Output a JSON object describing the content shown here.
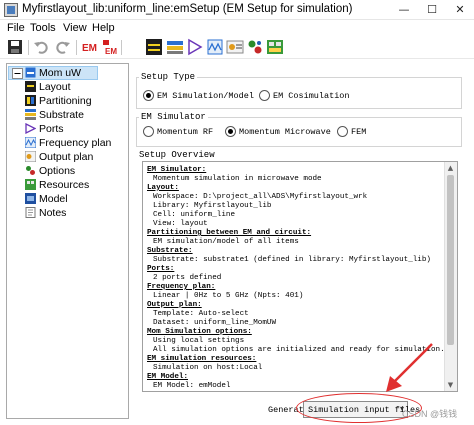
{
  "window": {
    "title": "Myfirstlayout_lib:uniform_line:emSetup (EM Setup for simulation)",
    "minimize": "—",
    "maximize": "☐",
    "close": "✕"
  },
  "menu": {
    "items": [
      "File",
      "Tools",
      "View",
      "Help"
    ]
  },
  "toolbar": {
    "buttons": [
      "save-icon",
      "undo-icon",
      "redo-icon",
      "em-icon",
      "em-cosim-icon",
      "layout-icon",
      "substrate-icon",
      "ports-icon",
      "frequency-icon",
      "output-icon",
      "options-icon",
      "resources-icon"
    ]
  },
  "tree": {
    "root": "Mom uW",
    "items": [
      "Layout",
      "Partitioning",
      "Substrate",
      "Ports",
      "Frequency plan",
      "Output plan",
      "Options",
      "Resources",
      "Model",
      "Notes"
    ]
  },
  "setup_type": {
    "group_label": "Setup Type",
    "options": [
      "EM Simulation/Model",
      "EM Cosimulation"
    ],
    "selected": "EM Simulation/Model"
  },
  "em_simulator": {
    "group_label": "EM Simulator",
    "options": [
      "Momentum RF",
      "Momentum Microwave",
      "FEM"
    ],
    "selected": "Momentum Microwave"
  },
  "overview": {
    "group_label": "Setup Overview",
    "lines": [
      {
        "text": "EM Simulator:",
        "type": "h"
      },
      {
        "text": "Momentum simulation in microwave mode",
        "type": "i"
      },
      {
        "text": "Layout:",
        "type": "h"
      },
      {
        "text": "Workspace: D:\\project_all\\ADS\\Myfirstlayout_wrk",
        "type": "i"
      },
      {
        "text": "Library: Myfirstlayout_lib",
        "type": "i"
      },
      {
        "text": "Cell: uniform_line",
        "type": "i"
      },
      {
        "text": "View: layout",
        "type": "i"
      },
      {
        "text": "Partitioning between EM and circuit:",
        "type": "h"
      },
      {
        "text": "EM simulation/model of all items",
        "type": "i"
      },
      {
        "text": "Substrate:",
        "type": "h"
      },
      {
        "text": "Substrate: substrate1 (defined in library: Myfirstlayout_lib)",
        "type": "i"
      },
      {
        "text": "Ports:",
        "type": "h"
      },
      {
        "text": "2 ports defined",
        "type": "i"
      },
      {
        "text": "Frequency plan:",
        "type": "h"
      },
      {
        "text": "Linear | 0Hz to 5 GHz (Npts: 401)",
        "type": "i"
      },
      {
        "text": "Output plan:",
        "type": "h"
      },
      {
        "text": "Template: Auto-select",
        "type": "i"
      },
      {
        "text": "Dataset: uniform_line_MomUW",
        "type": "i"
      },
      {
        "text": "Mom Simulation options:",
        "type": "h"
      },
      {
        "text": "Using local settings",
        "type": "i"
      },
      {
        "text": "All simulation options are initialized and ready for simulation.",
        "type": "i"
      },
      {
        "text": "EM simulation resources:",
        "type": "h"
      },
      {
        "text": "Simulation on host:Local",
        "type": "i"
      },
      {
        "text": "EM Model:",
        "type": "h"
      },
      {
        "text": "EM Model: emModel",
        "type": "i"
      }
    ]
  },
  "generate": {
    "label": "Generate:",
    "value": "Simulation input files"
  },
  "watermark": "CSDN @钱钱",
  "colors": {
    "selection": "#cce4f7",
    "annotation_red": "#e03030"
  }
}
